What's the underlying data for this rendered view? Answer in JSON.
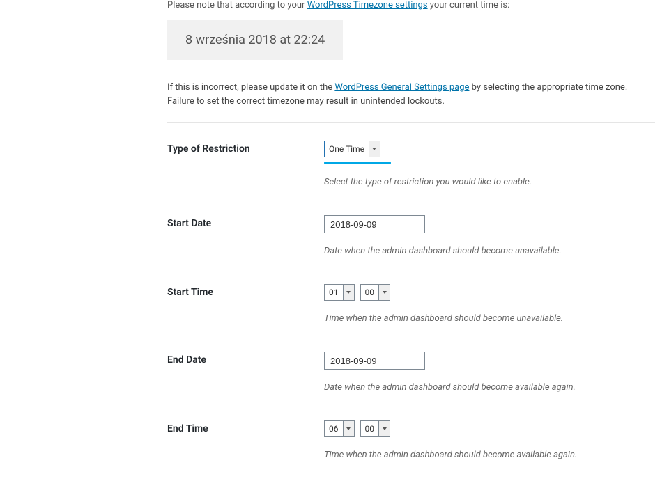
{
  "intro": {
    "prefix": "Please note that according to your ",
    "link": "WordPress Timezone settings",
    "suffix": " your current time is:"
  },
  "current_time": "8 września 2018 at 22:24",
  "warning": {
    "prefix": "If this is incorrect, please update it on the ",
    "link": "WordPress General Settings page",
    "suffix": " by selecting the appropriate time zone. Failure to set the correct timezone may result in unintended lockouts."
  },
  "fields": {
    "restriction": {
      "label": "Type of Restriction",
      "value": "One Time",
      "description": "Select the type of restriction you would like to enable."
    },
    "start_date": {
      "label": "Start Date",
      "value": "2018-09-09",
      "description": "Date when the admin dashboard should become unavailable."
    },
    "start_time": {
      "label": "Start Time",
      "hour": "01",
      "minute": "00",
      "description": "Time when the admin dashboard should become unavailable."
    },
    "end_date": {
      "label": "End Date",
      "value": "2018-09-09",
      "description": "Date when the admin dashboard should become available again."
    },
    "end_time": {
      "label": "End Time",
      "hour": "06",
      "minute": "00",
      "description": "Time when the admin dashboard should become available again."
    }
  }
}
